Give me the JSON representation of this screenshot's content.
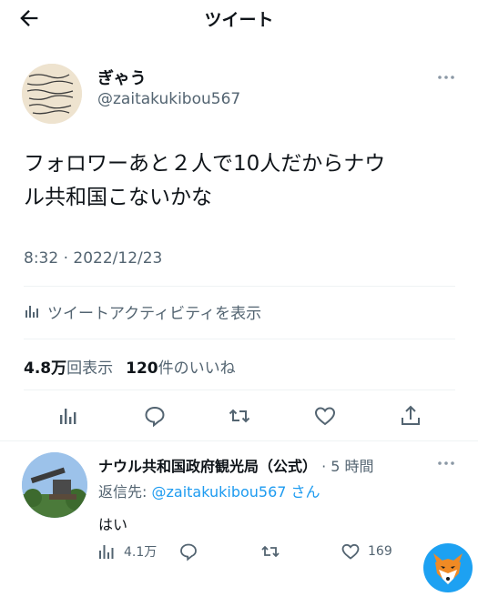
{
  "header": {
    "title": "ツイート",
    "back_icon": "back-arrow-icon"
  },
  "tweet": {
    "display_name": "ぎゃう",
    "handle": "@zaitakukibou567",
    "text_line1": "フォロワーあと２人で10人だからナウ",
    "text_line2": "ル共和国こないかな",
    "timestamp": "8:32 · 2022/12/23",
    "activity_label": "ツイートアクティビティを表示",
    "views_count": "4.8万",
    "views_label": "回表示",
    "likes_count": "120",
    "likes_label": "件のいいね",
    "actions": [
      "analytics-icon",
      "reply-icon",
      "retweet-icon",
      "like-icon",
      "share-icon"
    ]
  },
  "reply": {
    "display_name": "ナウル共和国政府観光局（公式）",
    "time": "· 5 時間",
    "reply_to_prefix": "返信先: ",
    "reply_to_handle": "@zaitakukibou567",
    "reply_to_suffix": " さん",
    "text": "はい",
    "views": "4.1万",
    "likes": "169"
  },
  "colors": {
    "text": "#0f1419",
    "secondary": "#536471",
    "link": "#1d9bf0",
    "divider": "#eff3f4"
  }
}
